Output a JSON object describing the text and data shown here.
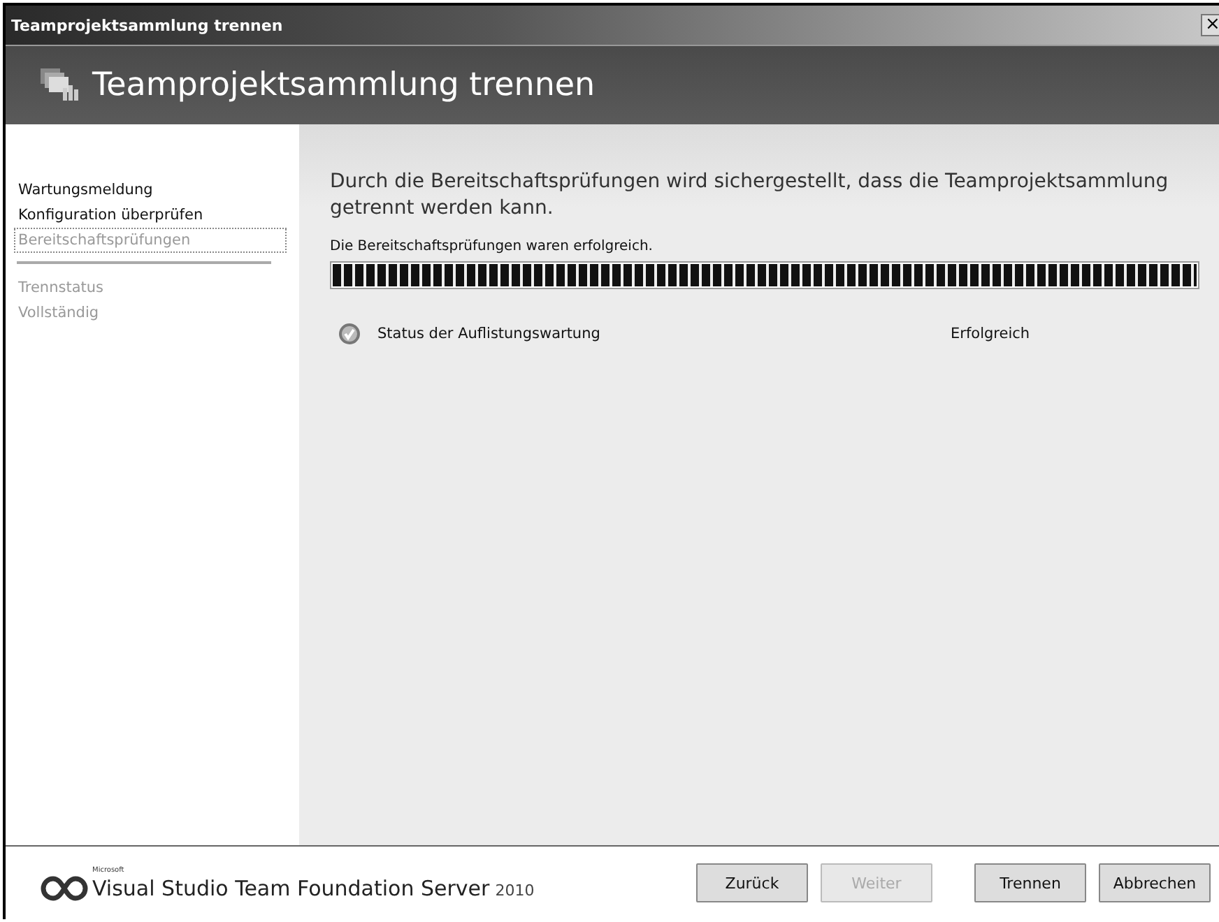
{
  "window": {
    "title": "Teamprojektsammlung trennen",
    "close": "×"
  },
  "header": {
    "title": "Teamprojektsammlung trennen"
  },
  "sidebar": {
    "items": [
      {
        "label": "Wartungsmeldung",
        "done": true,
        "selected": false,
        "divider_after": false
      },
      {
        "label": "Konfiguration überprüfen",
        "done": true,
        "selected": false,
        "divider_after": false
      },
      {
        "label": "Bereitschaftsprüfungen",
        "done": false,
        "selected": true,
        "divider_after": true
      },
      {
        "label": "Trennstatus",
        "done": false,
        "selected": false,
        "divider_after": false
      },
      {
        "label": "Vollständig",
        "done": false,
        "selected": false,
        "divider_after": false
      }
    ]
  },
  "content": {
    "description": "Durch die Bereitschaftsprüfungen wird sichergestellt, dass die Teamprojektsammlung getrennt werden kann.",
    "progress_label": "Die Bereitschaftsprüfungen waren erfolgreich.",
    "progress": {
      "level": 1
    },
    "checks": [
      {
        "name": "Status der Auflistungswartung",
        "result": "Erfolgreich",
        "passed": true
      }
    ]
  },
  "footer": {
    "logo": {
      "maker": "Microsoft",
      "product": "Visual Studio Team Foundation Server",
      "year": "2010"
    },
    "buttons": [
      {
        "label": "Zurück",
        "disabled": false
      },
      {
        "label": "Weiter",
        "disabled": true
      },
      {
        "label": "Trennen",
        "disabled": false
      },
      {
        "label": "Abbrechen",
        "disabled": false
      }
    ]
  }
}
